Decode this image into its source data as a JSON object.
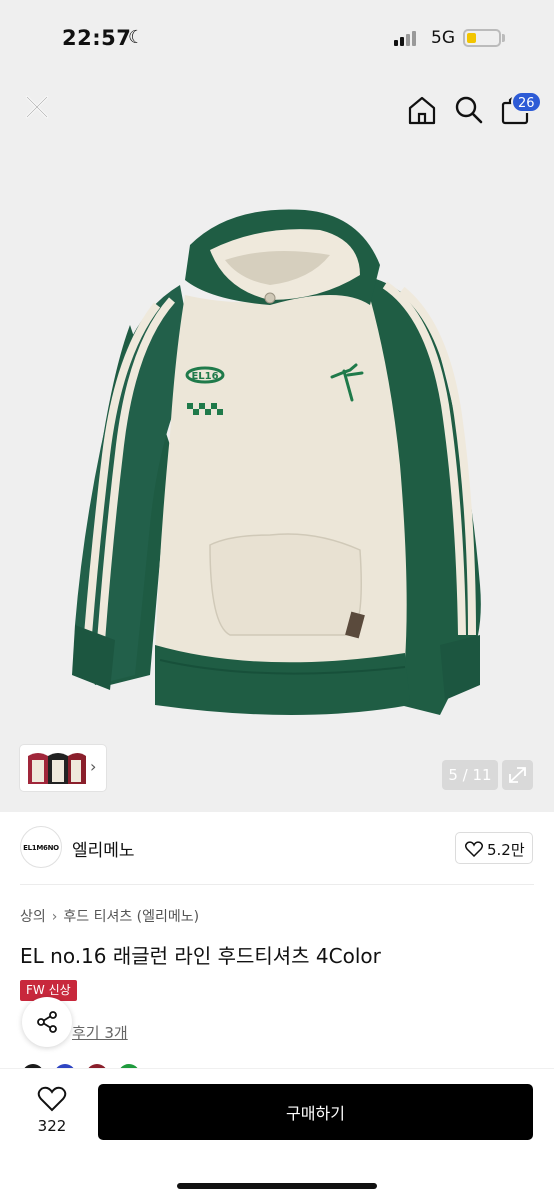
{
  "status_bar": {
    "time": "22:57",
    "network": "5G",
    "battery_level": 0.3
  },
  "header": {
    "cart_count": "26"
  },
  "gallery": {
    "page_indicator": "5 / 11",
    "current_page": 5,
    "total_pages": 11
  },
  "product_print": {
    "chest_logo_text": "EL16"
  },
  "brand": {
    "logo_text": "EL1M6NO",
    "name": "엘리메노",
    "likes": "5.2만"
  },
  "breadcrumb": {
    "items": [
      "상의",
      "후드 티셔츠 (엘리메노)"
    ]
  },
  "product": {
    "title": "EL no.16 래글런 라인 후드티셔츠 4Color",
    "tag": "FW 신상",
    "reviews_label": "후기 3개"
  },
  "colors": {
    "swatches": [
      "#1a1a1a",
      "#2f45c2",
      "#8a1f2b",
      "#1e9a3c"
    ],
    "accent": "#2d5bd6",
    "tag_color": "#c8283c"
  },
  "bottom": {
    "wish_count": "322",
    "buy_label": "구매하기"
  }
}
